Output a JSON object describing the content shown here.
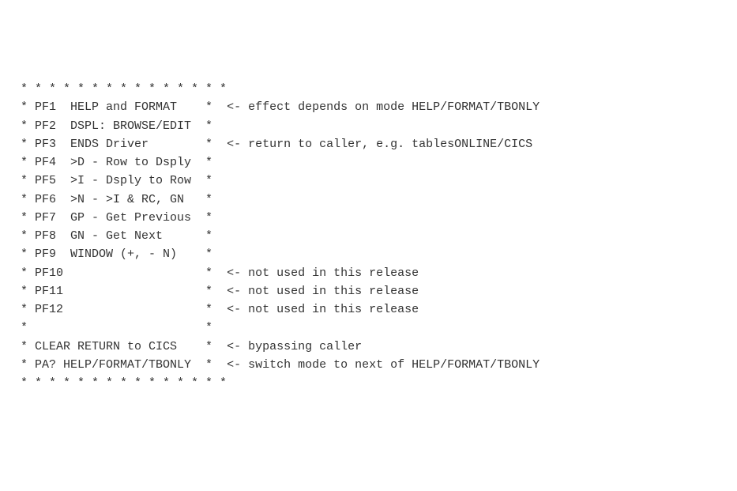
{
  "rows": [
    {
      "pad": "  ",
      "label": "* * * * * * * * * * * * * * *",
      "comment": ""
    },
    {
      "pad": "  ",
      "label": "* PF1  HELP and FORMAT    *",
      "comment": "  <- effect depends on mode HELP/FORMAT/TBONLY"
    },
    {
      "pad": "  ",
      "label": "* PF2  DSPL: BROWSE/EDIT  *",
      "comment": ""
    },
    {
      "pad": "  ",
      "label": "* PF3  ENDS Driver        *",
      "comment": "  <- return to caller, e.g. tablesONLINE/CICS"
    },
    {
      "pad": "  ",
      "label": "* PF4  >D - Row to Dsply  *",
      "comment": ""
    },
    {
      "pad": "  ",
      "label": "* PF5  >I - Dsply to Row  *",
      "comment": ""
    },
    {
      "pad": "  ",
      "label": "* PF6  >N - >I & RC, GN   *",
      "comment": ""
    },
    {
      "pad": "  ",
      "label": "* PF7  GP - Get Previous  *",
      "comment": ""
    },
    {
      "pad": "  ",
      "label": "* PF8  GN - Get Next      *",
      "comment": ""
    },
    {
      "pad": "  ",
      "label": "* PF9  WINDOW (+, - N)    *",
      "comment": ""
    },
    {
      "pad": "  ",
      "label": "* PF10                    *",
      "comment": "  <- not used in this release"
    },
    {
      "pad": "  ",
      "label": "* PF11                    *",
      "comment": "  <- not used in this release"
    },
    {
      "pad": "  ",
      "label": "* PF12                    *",
      "comment": "  <- not used in this release"
    },
    {
      "pad": "  ",
      "label": "*                         *",
      "comment": ""
    },
    {
      "pad": "  ",
      "label": "* CLEAR RETURN to CICS    *",
      "comment": "  <- bypassing caller"
    },
    {
      "pad": "  ",
      "label": "* PA? HELP/FORMAT/TBONLY  *",
      "comment": "  <- switch mode to next of HELP/FORMAT/TBONLY"
    },
    {
      "pad": "  ",
      "label": "* * * * * * * * * * * * * * *",
      "comment": ""
    }
  ]
}
